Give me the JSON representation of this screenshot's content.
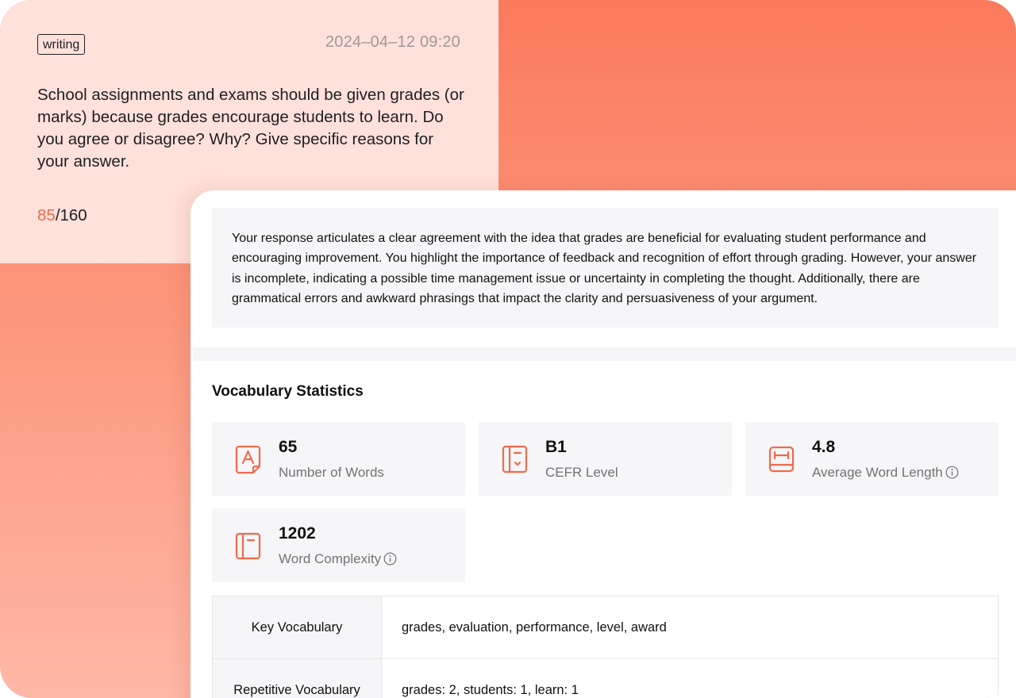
{
  "prompt": {
    "tag": "writing",
    "timestamp": "2024–04–12 09:20",
    "text": "School assignments and exams should be given grades (or marks) because grades encourage students to learn. Do you agree or disagree? Why? Give specific reasons for your answer.",
    "score_value": "85",
    "score_total": "/160"
  },
  "feedback": {
    "text": "Your response articulates a clear agreement with the idea that grades are beneficial for evaluating student performance and encouraging improvement.  You highlight the importance of feedback and recognition of effort through grading.  However, your answer is incomplete, indicating a possible time management issue or uncertainty in completing the thought.  Additionally, there are grammatical errors and awkward phrasings that impact the clarity and persuasiveness of your argument."
  },
  "vocabulary": {
    "title": "Vocabulary Statistics",
    "stats": [
      {
        "value": "65",
        "label": "Number of Words",
        "icon": "letter-a-icon"
      },
      {
        "value": "B1",
        "label": "CEFR Level",
        "icon": "book-level-icon"
      },
      {
        "value": "4.8",
        "label": "Average Word Length",
        "icon": "width-ruler-icon",
        "info": true
      },
      {
        "value": "1202",
        "label": "Word Complexity",
        "icon": "book-icon",
        "info": true
      }
    ],
    "table": [
      {
        "label": "Key Vocabulary",
        "value": "grades, evaluation, performance, level, award"
      },
      {
        "label": "Repetitive Vocabulary",
        "value": "grades: 2, students: 1, learn: 1"
      }
    ]
  },
  "colors": {
    "accent": "#f06a4a",
    "gradient_top": "#fb7a5c",
    "gradient_bottom": "#feb8a6",
    "prompt_card_bg": "#ffe1db",
    "panel_gray": "#f6f6f8"
  }
}
